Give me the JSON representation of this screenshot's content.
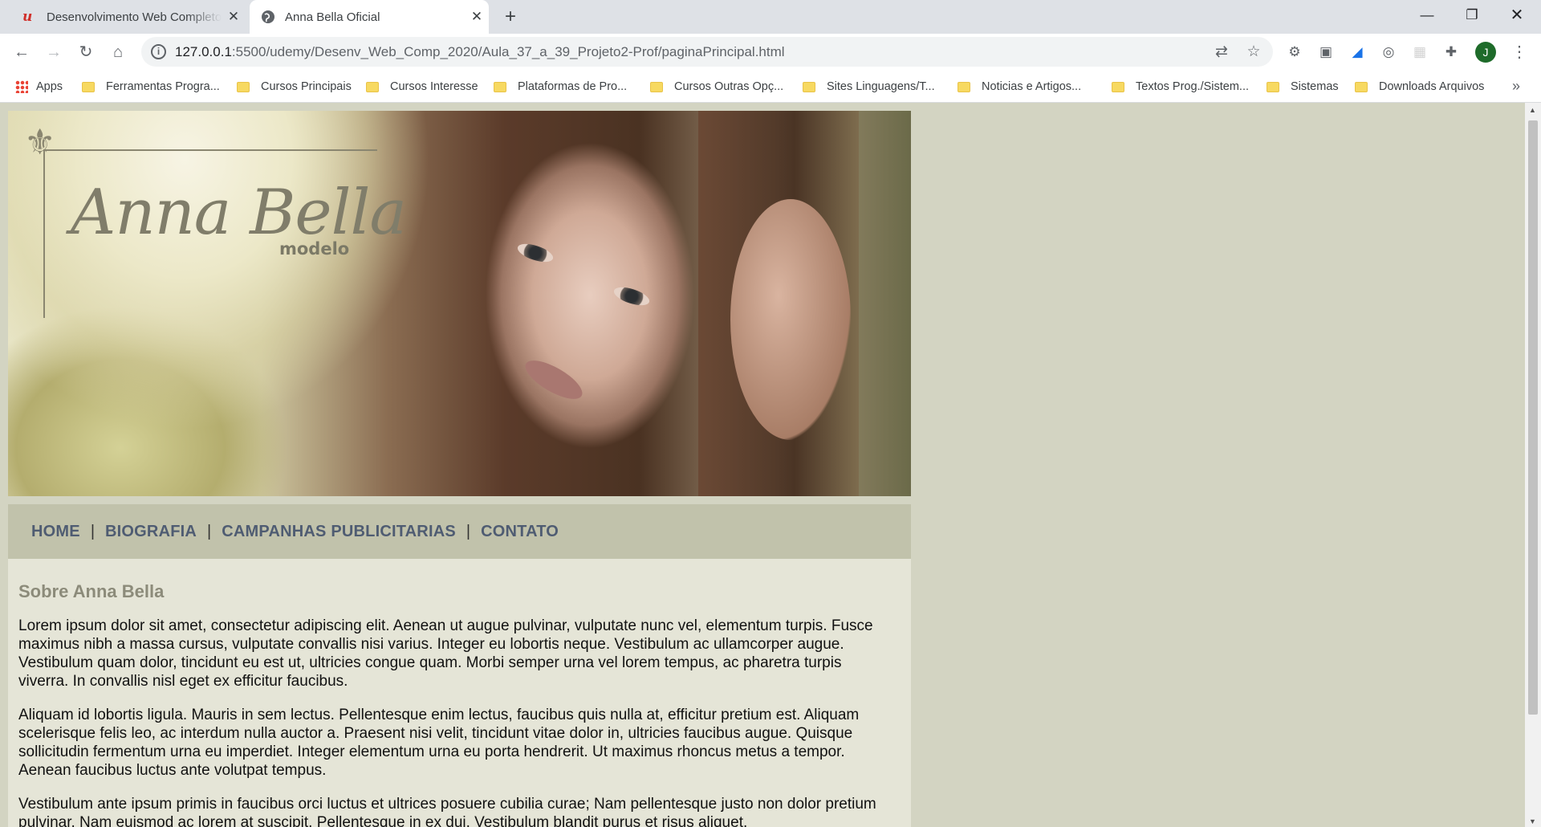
{
  "browser": {
    "tabs": [
      {
        "title": "Desenvolvimento Web Completo",
        "icon": "udemy-icon"
      },
      {
        "title": "Anna Bella Oficial",
        "icon": "globe-icon"
      }
    ],
    "url_host": "127.0.0.1",
    "url_rest": ":5500/udemy/Desenv_Web_Comp_2020/Aula_37_a_39_Projeto2-Prof/paginaPrincipal.html",
    "profile_initial": "J",
    "bookmarks": [
      "Apps",
      "Ferramentas Progra...",
      "Cursos Principais",
      "Cursos Interesse",
      "Plataformas de Pro...",
      "Cursos Outras Opç...",
      "Sites Linguagens/T...",
      "Noticias e Artigos...",
      "Textos Prog./Sistem...",
      "Sistemas",
      "Downloads Arquivos"
    ]
  },
  "page": {
    "logo": {
      "name": "Anna Bella",
      "subtitle": "modelo"
    },
    "menu": [
      "HOME",
      "BIOGRAFIA",
      "CAMPANHAS PUBLICITARIAS",
      "CONTATO"
    ],
    "heading": "Sobre Anna Bella",
    "paragraphs": [
      "Lorem ipsum dolor sit amet, consectetur adipiscing elit. Aenean ut augue pulvinar, vulputate nunc vel, elementum turpis. Fusce maximus nibh a massa cursus, vulputate convallis nisi varius. Integer eu lobortis neque. Vestibulum ac ullamcorper augue. Vestibulum quam dolor, tincidunt eu est ut, ultricies congue quam. Morbi semper urna vel lorem tempus, ac pharetra turpis viverra. In convallis nisl eget ex efficitur faucibus.",
      "Aliquam id lobortis ligula. Mauris in sem lectus. Pellentesque enim lectus, faucibus quis nulla at, efficitur pretium est. Aliquam scelerisque felis leo, ac interdum nulla auctor a. Praesent nisi velit, tincidunt vitae dolor in, ultricies faucibus augue. Quisque sollicitudin fermentum urna eu imperdiet. Integer elementum urna eu porta hendrerit. Ut maximus rhoncus metus a tempor. Aenean faucibus luctus ante volutpat tempus.",
      "Vestibulum ante ipsum primis in faucibus orci luctus et ultrices posuere cubilia curae; Nam pellentesque justo non dolor pretium pulvinar. Nam euismod ac lorem at suscipit. Pellentesque in ex dui. Vestibulum blandit purus et risus aliquet."
    ]
  },
  "colors": {
    "page_bg": "#d3d4c2",
    "menu_bg": "#c1c2ab",
    "menu_text": "#4f5c72",
    "content_bg": "#e5e5d7",
    "heading": "#8c8b7a"
  }
}
